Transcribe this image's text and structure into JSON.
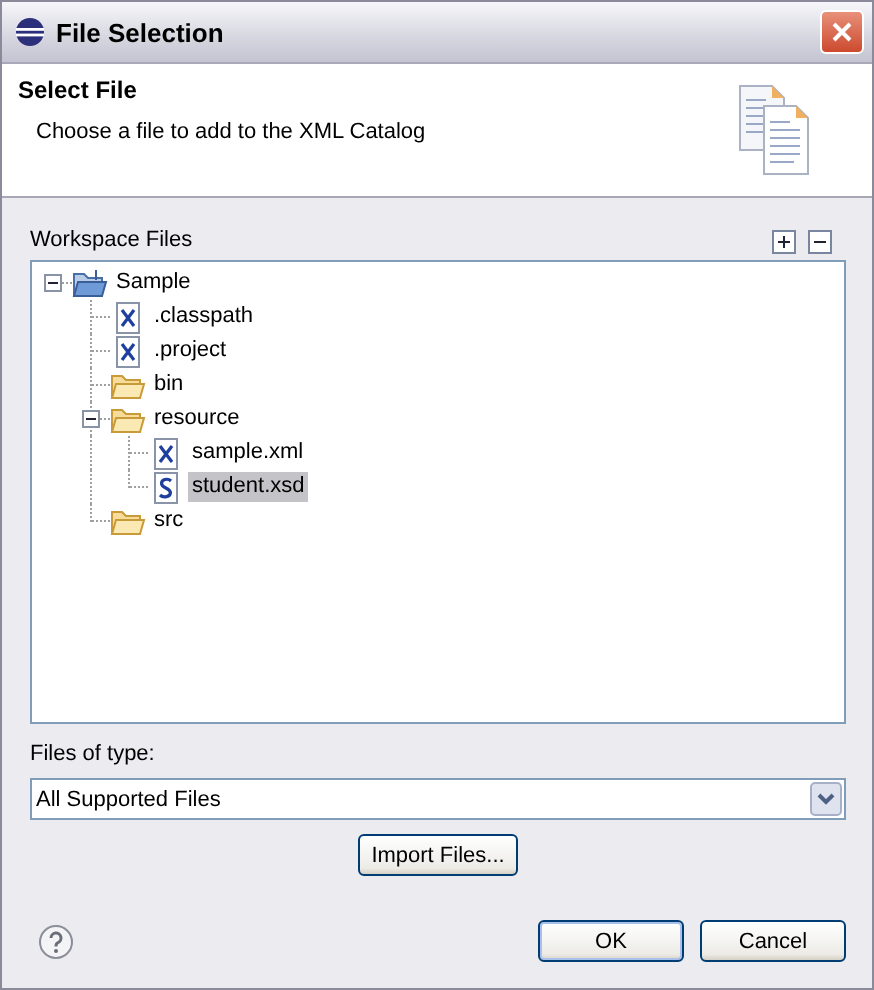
{
  "window": {
    "title": "File Selection"
  },
  "header": {
    "title": "Select File",
    "description": "Choose a file to add to the XML Catalog"
  },
  "workspace": {
    "label": "Workspace Files",
    "tree": [
      {
        "label": "Sample",
        "kind": "project",
        "expanded": true,
        "selected": false,
        "children": [
          {
            "label": ".classpath",
            "kind": "xml",
            "selected": false
          },
          {
            "label": ".project",
            "kind": "xml",
            "selected": false
          },
          {
            "label": "bin",
            "kind": "folder",
            "selected": false
          },
          {
            "label": "resource",
            "kind": "folder",
            "expanded": true,
            "selected": false,
            "children": [
              {
                "label": "sample.xml",
                "kind": "xml",
                "selected": false
              },
              {
                "label": "student.xsd",
                "kind": "xsd",
                "selected": true
              }
            ]
          },
          {
            "label": "src",
            "kind": "folder",
            "selected": false
          }
        ]
      }
    ]
  },
  "file_type": {
    "label": "Files of type:",
    "value": "All Supported Files"
  },
  "import_button": "Import Files...",
  "buttons": [
    "OK",
    "Cancel"
  ]
}
